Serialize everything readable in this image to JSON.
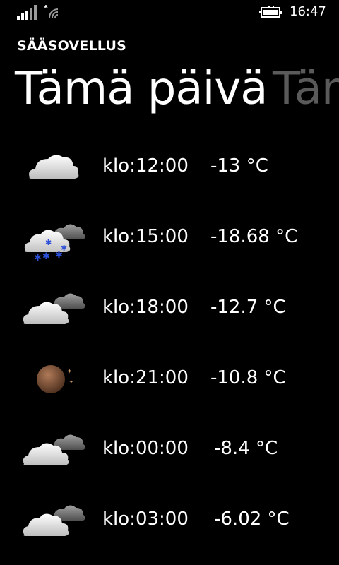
{
  "status_bar": {
    "time": "16:47",
    "icons": [
      "signal-strength-icon",
      "wifi-icon",
      "battery-charging-icon"
    ]
  },
  "app": {
    "title": "SÄÄSOVELLUS"
  },
  "pivot": {
    "active": "Tämä päivä",
    "next_peek": "Tän"
  },
  "forecast": [
    {
      "time": "klo:12:00",
      "temp": "-13 °C",
      "icon": "cloudy-icon"
    },
    {
      "time": "klo:15:00",
      "temp": "-18.68 °C",
      "icon": "snow-cloud-icon"
    },
    {
      "time": "klo:18:00",
      "temp": "-12.7 °C",
      "icon": "partly-cloudy-night-icon"
    },
    {
      "time": "klo:21:00",
      "temp": "-10.8 °C",
      "icon": "clear-night-moon-icon"
    },
    {
      "time": "klo:00:00",
      "temp": "-8.4 °C",
      "icon": "partly-cloudy-night-icon"
    },
    {
      "time": "klo:03:00",
      "temp": "-6.02 °C",
      "icon": "partly-cloudy-night-icon"
    }
  ]
}
